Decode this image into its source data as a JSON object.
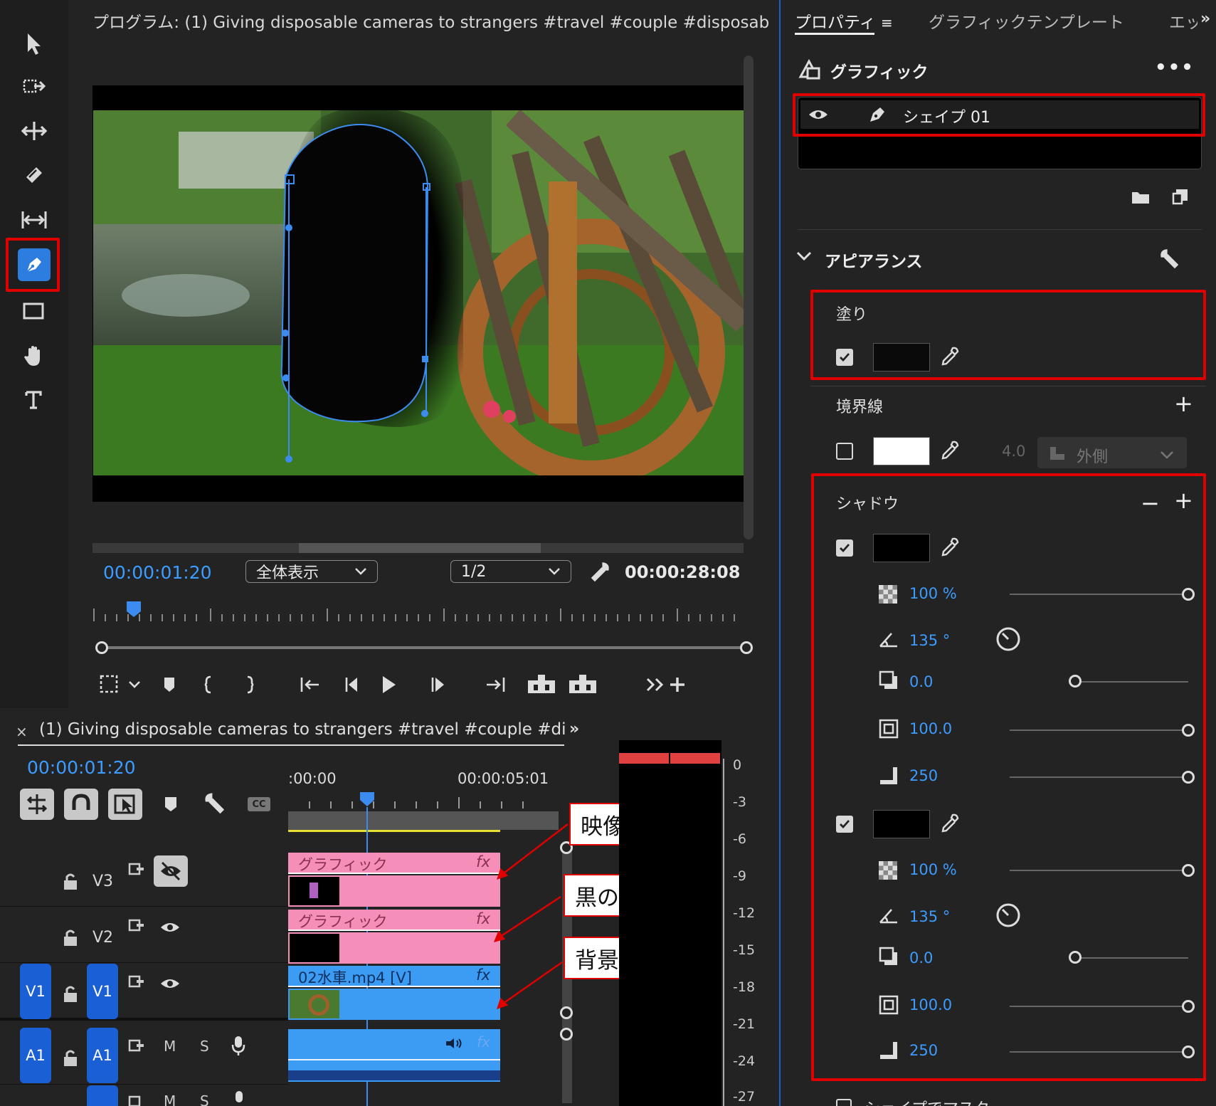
{
  "program_monitor": {
    "title": "プログラム: (1) Giving disposable cameras to strangers #travel #couple #disposabl",
    "current_timecode": "00:00:01:20",
    "zoom_select": "全体表示",
    "resolution_select": "1/2",
    "duration": "00:00:28:08"
  },
  "properties_panel": {
    "tabs": [
      "プロパティ",
      "グラフィックテンプレート",
      "エッ"
    ],
    "section_graphic": "グラフィック",
    "layer_name": "シェイプ 01",
    "appearance": "アピアランス",
    "fill_label": "塗り",
    "fill_color": "#0a0a0a",
    "stroke_label": "境界線",
    "stroke_width": "4.0",
    "stroke_position": "外側",
    "shadow_label": "シャドウ",
    "shadows": [
      {
        "opacity": "100 %",
        "angle": "135 °",
        "distance": "0.0",
        "size": "100.0",
        "blur": "250"
      },
      {
        "opacity": "100 %",
        "angle": "135 °",
        "distance": "0.0",
        "size": "100.0",
        "blur": "250"
      }
    ],
    "mask_label": "シェイプでマスク"
  },
  "timeline": {
    "title": "(1) Giving disposable cameras to strangers #travel #couple #dis",
    "current_timecode": "00:00:01:20",
    "ruler_start": ":00:00",
    "ruler_mark": "00:00:05:01",
    "tracks": {
      "v3": "V3",
      "v2": "V2",
      "v1": "V1",
      "a1": "A1",
      "mute": "M",
      "solo": "S"
    },
    "clips": {
      "v3_clip": "グラフィック",
      "v2_clip": "グラフィック",
      "v1_clip": "02水車.mp4 [V]",
      "fx": "fx"
    }
  },
  "audio_meter": {
    "scale": [
      "0",
      "-3",
      "-6",
      "-9",
      "-12",
      "-15",
      "-18",
      "-21",
      "-24",
      "-27"
    ]
  },
  "annotations": {
    "video": "映像",
    "black_bg": "黒の背景",
    "background": "背景"
  }
}
